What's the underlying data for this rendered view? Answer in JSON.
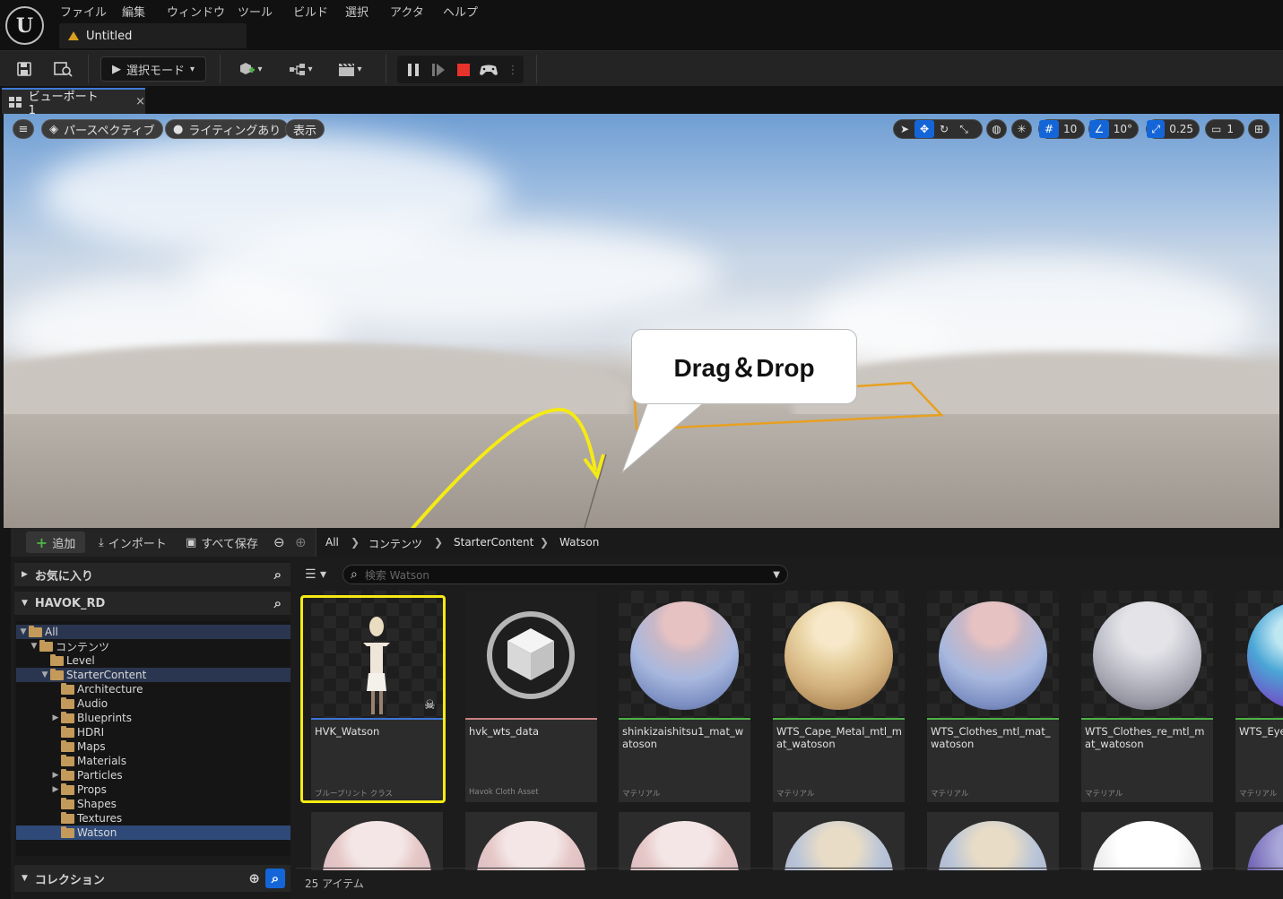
{
  "app": {
    "menu": [
      "ファイル",
      "編集",
      "ウィンドウ",
      "ツール",
      "ビルド",
      "選択",
      "アクタ",
      "ヘルプ"
    ],
    "document_tab": "Untitled"
  },
  "toolbar": {
    "mode_label": "選択モード"
  },
  "viewport": {
    "tab_label": "ビューポート1",
    "perspective_label": "パースペクティブ",
    "lighting_label": "ライティングあり",
    "show_label": "表示",
    "grid_snap": "10",
    "rotation_snap": "10°",
    "scale_snap": "0.25",
    "camera_speed": "1",
    "callout_text": "Drag＆Drop"
  },
  "content_browser": {
    "add_label": "追加",
    "import_label": "インポート",
    "save_all_label": "すべて保存",
    "breadcrumb": [
      "All",
      "コンテンツ",
      "StarterContent",
      "Watson"
    ],
    "favorites_label": "お気に入り",
    "project_label": "HAVOK_RD",
    "collections_label": "コレクション",
    "search_placeholder": "検索 Watson",
    "tree": [
      {
        "label": "All",
        "depth": 0,
        "expanded": true
      },
      {
        "label": "コンテンツ",
        "depth": 1,
        "expanded": true
      },
      {
        "label": "Level",
        "depth": 2,
        "expanded": false
      },
      {
        "label": "StarterContent",
        "depth": 2,
        "expanded": true
      },
      {
        "label": "Architecture",
        "depth": 3,
        "expanded": false
      },
      {
        "label": "Audio",
        "depth": 3,
        "expanded": false
      },
      {
        "label": "Blueprints",
        "depth": 3,
        "expanded": false
      },
      {
        "label": "HDRI",
        "depth": 3,
        "expanded": false
      },
      {
        "label": "Maps",
        "depth": 3,
        "expanded": false
      },
      {
        "label": "Materials",
        "depth": 3,
        "expanded": false
      },
      {
        "label": "Particles",
        "depth": 3,
        "expanded": false
      },
      {
        "label": "Props",
        "depth": 3,
        "expanded": false
      },
      {
        "label": "Shapes",
        "depth": 3,
        "expanded": false
      },
      {
        "label": "Textures",
        "depth": 3,
        "expanded": false
      },
      {
        "label": "Watson",
        "depth": 3,
        "expanded": false
      }
    ],
    "assets": [
      {
        "name": "HVK_Watson",
        "type": "ブループリント クラス"
      },
      {
        "name": "hvk_wts_data",
        "type": "Havok Cloth Asset"
      },
      {
        "name": "shinkizaishitsu1_mat_watoson",
        "type": "マテリアル"
      },
      {
        "name": "WTS_Cape_Metal_mtl_mat_watoson",
        "type": "マテリアル"
      },
      {
        "name": "WTS_Clothes_mtl_mat_watoson",
        "type": "マテリアル"
      },
      {
        "name": "WTS_Clothes_re_mtl_mat_watoson",
        "type": "マテリアル"
      },
      {
        "name": "WTS_Eye_watoson",
        "type": "マテリアル"
      }
    ],
    "item_count": "25 アイテム"
  },
  "colors": {
    "accent_blue": "#1466d8",
    "highlight_yellow": "#f5ea14",
    "blueprint_bar": "#3d74d6",
    "cloth_bar": "#c88080",
    "material_bar": "#4fb046"
  }
}
